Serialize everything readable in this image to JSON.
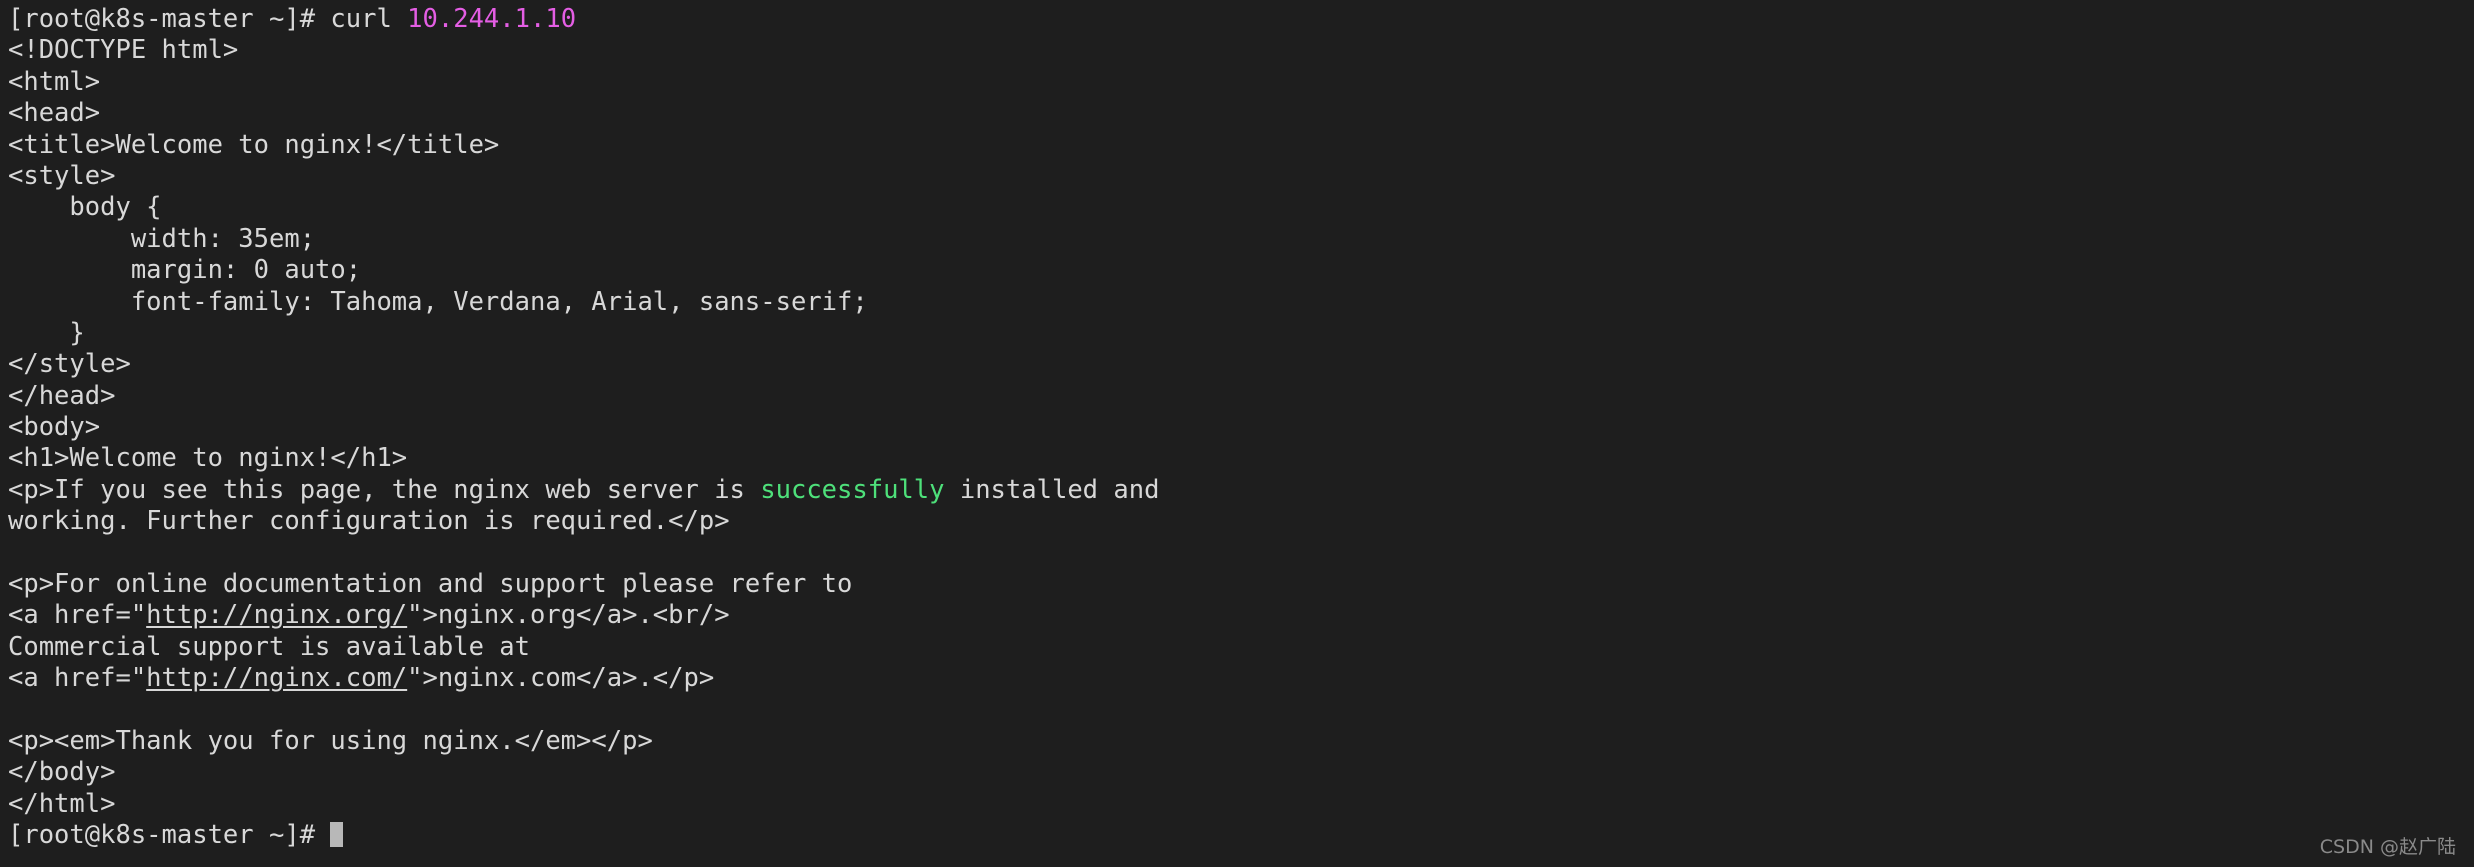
{
  "terminal": {
    "background_color": "#1e1e1e",
    "foreground_color": "#d8d8d8",
    "accent_ip_color": "#e45ee4",
    "accent_success_color": "#4ee07a",
    "cursor_color": "#b8b8b8",
    "prompt": "[root@k8s-master ~]#",
    "command": " curl ",
    "command_argument": "10.244.1.10",
    "lines": [
      {
        "kind": "command",
        "prompt": "[root@k8s-master ~]#",
        "command": " curl ",
        "argument": "10.244.1.10"
      },
      {
        "kind": "text",
        "text": "<!DOCTYPE html>"
      },
      {
        "kind": "text",
        "text": "<html>"
      },
      {
        "kind": "text",
        "text": "<head>"
      },
      {
        "kind": "text",
        "text": "<title>Welcome to nginx!</title>"
      },
      {
        "kind": "text",
        "text": "<style>"
      },
      {
        "kind": "text",
        "text": "    body {"
      },
      {
        "kind": "text",
        "text": "        width: 35em;"
      },
      {
        "kind": "text",
        "text": "        margin: 0 auto;"
      },
      {
        "kind": "text",
        "text": "        font-family: Tahoma, Verdana, Arial, sans-serif;"
      },
      {
        "kind": "text",
        "text": "    }"
      },
      {
        "kind": "text",
        "text": "</style>"
      },
      {
        "kind": "text",
        "text": "</head>"
      },
      {
        "kind": "text",
        "text": "<body>"
      },
      {
        "kind": "text",
        "text": "<h1>Welcome to nginx!</h1>"
      },
      {
        "kind": "success",
        "before": "<p>If you see this page, the nginx web server is ",
        "highlight": "successfully",
        "after": " installed and"
      },
      {
        "kind": "text",
        "text": "working. Further configuration is required.</p>"
      },
      {
        "kind": "blank",
        "text": ""
      },
      {
        "kind": "text",
        "text": "<p>For online documentation and support please refer to"
      },
      {
        "kind": "link",
        "before": "<a href=\"",
        "url": "http://nginx.org/",
        "after": "\">nginx.org</a>.<br/>"
      },
      {
        "kind": "text",
        "text": "Commercial support is available at"
      },
      {
        "kind": "link",
        "before": "<a href=\"",
        "url": "http://nginx.com/",
        "after": "\">nginx.com</a>.</p>"
      },
      {
        "kind": "blank",
        "text": ""
      },
      {
        "kind": "text",
        "text": "<p><em>Thank you for using nginx.</em></p>"
      },
      {
        "kind": "text",
        "text": "</body>"
      },
      {
        "kind": "text",
        "text": "</html>"
      },
      {
        "kind": "prompt",
        "prompt": "[root@k8s-master ~]# "
      }
    ]
  },
  "watermark": {
    "text": "CSDN @赵广陆"
  }
}
